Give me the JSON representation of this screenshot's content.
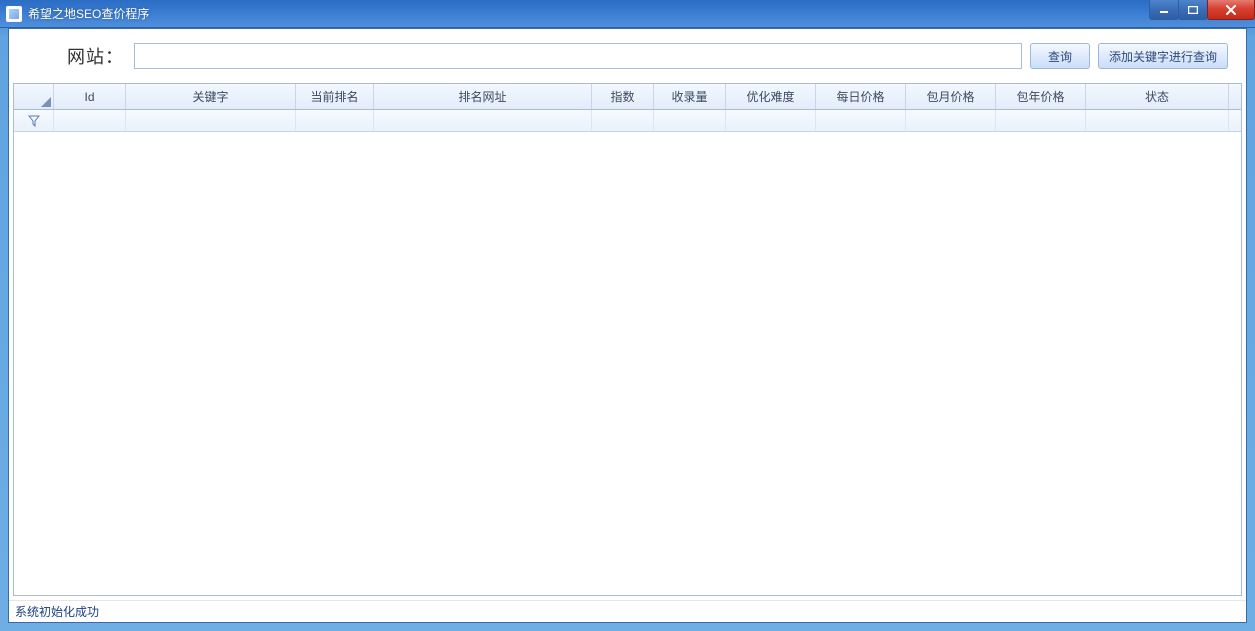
{
  "window": {
    "title": "希望之地SEO查价程序"
  },
  "search": {
    "label": "网站：",
    "value": "",
    "queryButton": "查询",
    "addKeywordButton": "添加关键字进行查询"
  },
  "grid": {
    "columns": {
      "id": "Id",
      "keyword": "关键字",
      "currentRank": "当前排名",
      "rankUrl": "排名网址",
      "index": "指数",
      "included": "收录量",
      "difficulty": "优化难度",
      "dailyPrice": "每日价格",
      "monthlyPrice": "包月价格",
      "yearlyPrice": "包年价格",
      "status": "状态"
    },
    "rows": []
  },
  "statusbar": {
    "text": "系统初始化成功"
  }
}
